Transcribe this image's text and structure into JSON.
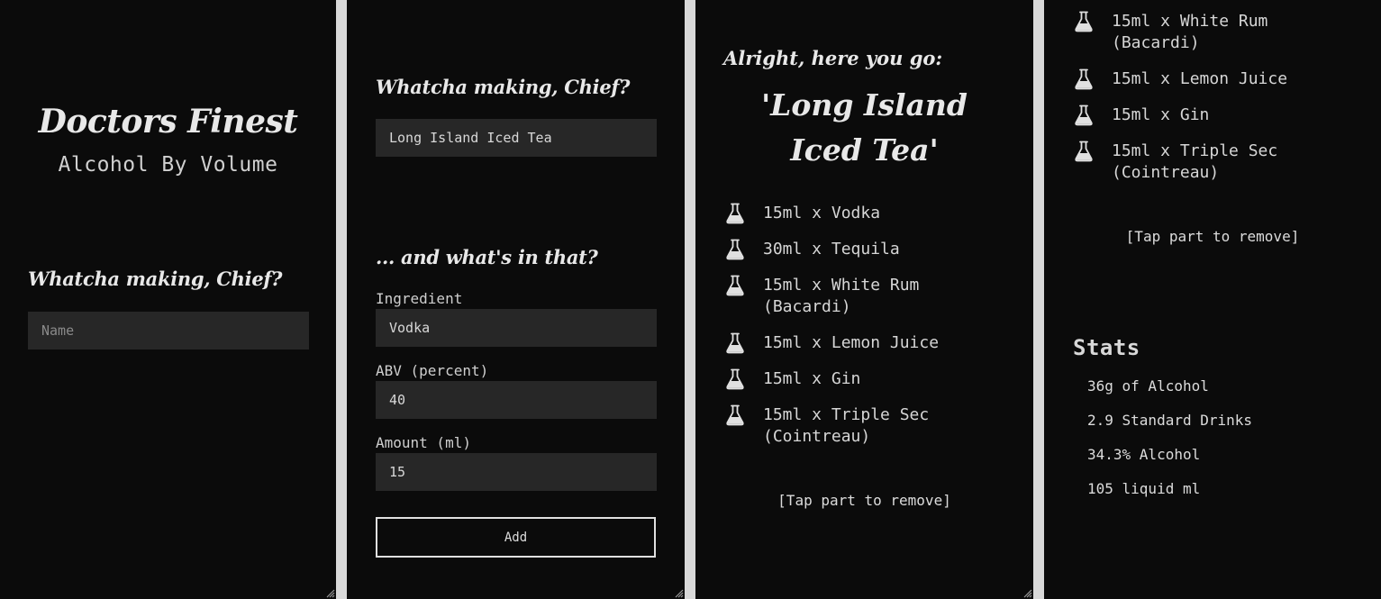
{
  "app": {
    "title": "Doctors Finest",
    "subtitle": "Alcohol By Volume"
  },
  "name_form": {
    "heading": "Whatcha making, Chief?",
    "name_placeholder": "Name"
  },
  "ingredient_form": {
    "heading": "Whatcha making, Chief?",
    "name_value": "Long Island Iced Tea",
    "section_heading": "... and what's in that?",
    "ingredient_label": "Ingredient",
    "ingredient_value": "Vodka",
    "abv_label": "ABV (percent)",
    "abv_value": "40",
    "amount_label": "Amount (ml)",
    "amount_value": "15",
    "add_label": "Add"
  },
  "recipe": {
    "intro": "Alright, here you go:",
    "drink_name": "'Long Island Iced Tea'",
    "ingredients": [
      "15ml x Vodka",
      "30ml x Tequila",
      "15ml x White Rum (Bacardi)",
      "15ml x Lemon Juice",
      "15ml x Gin",
      "15ml x Triple Sec (Cointreau)"
    ],
    "tap_hint": "[Tap part to remove]"
  },
  "recipe_scrolled": {
    "ingredients": [
      "15ml x White Rum (Bacardi)",
      "15ml x Lemon Juice",
      "15ml x Gin",
      "15ml x Triple Sec (Cointreau)"
    ],
    "tap_hint": "[Tap part to remove]",
    "stats_title": "Stats",
    "stats": [
      "36g of Alcohol",
      "2.9 Standard Drinks",
      "34.3% Alcohol",
      "105 liquid ml"
    ]
  },
  "icons": {
    "ingredient": "flask-icon",
    "resize": "resize-grip-icon"
  },
  "colors": {
    "panel_bg": "#0b0b0b",
    "gutter": "#d9d9d9",
    "input_bg": "#272727",
    "text": "#e6e6e6"
  }
}
